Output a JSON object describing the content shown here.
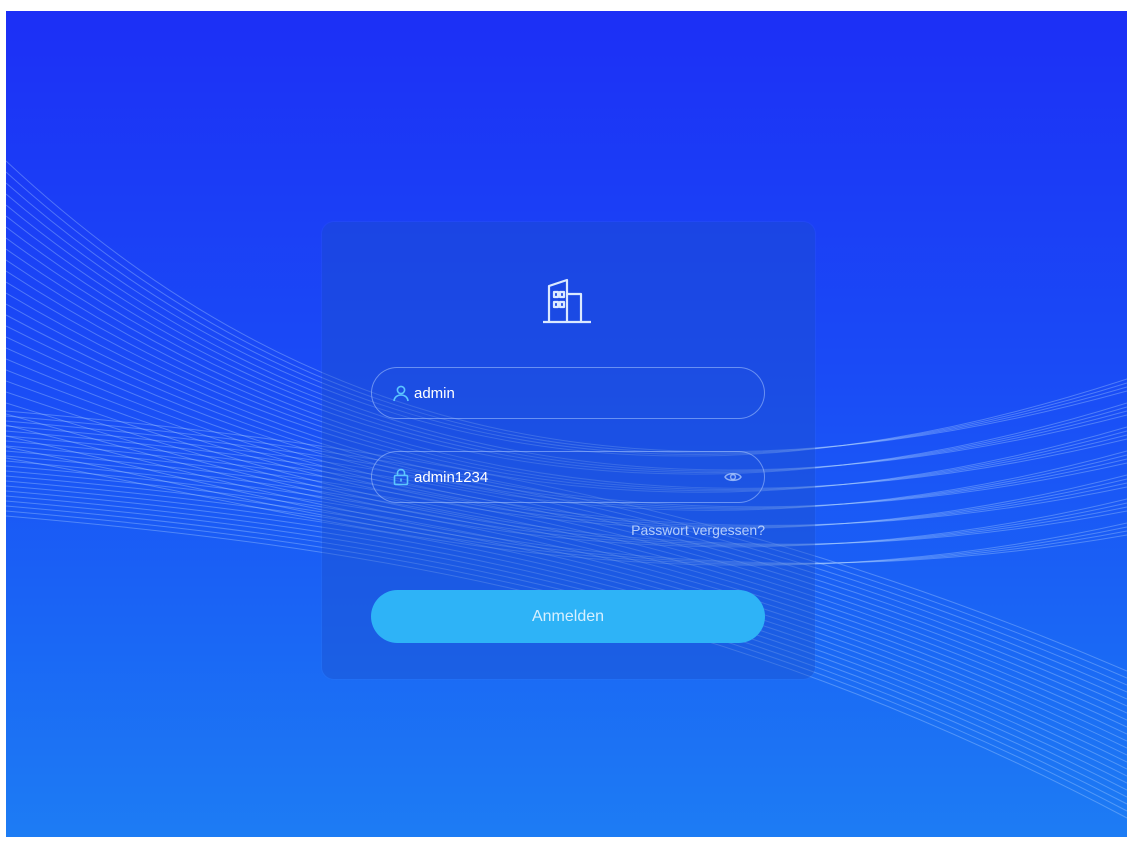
{
  "login": {
    "username_value": "admin",
    "password_value": "admin1234",
    "forgot_password_label": "Passwort vergessen?",
    "submit_label": "Anmelden"
  },
  "icons": {
    "logo": "building-icon",
    "username": "user-icon",
    "password": "lock-icon",
    "toggle_password": "eye-icon"
  },
  "colors": {
    "background_top": "#1c2ff6",
    "background_bottom": "#1d7cf4",
    "accent_button": "#2eb3f7",
    "icon_accent": "#5cc6ff"
  }
}
